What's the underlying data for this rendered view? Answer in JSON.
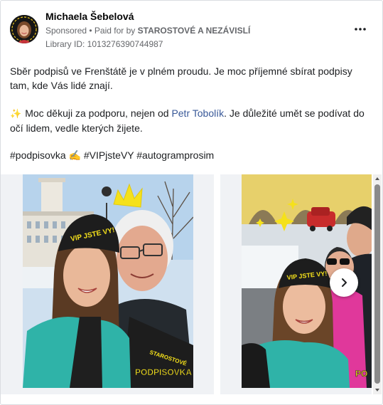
{
  "post": {
    "author": "Michaela Šebelová",
    "sponsored_label": "Sponsored",
    "separator": " • ",
    "paid_for_prefix": "Paid for by ",
    "paid_for_by": "STAROSTOVÉ A NEZÁVISLÍ",
    "library_id": "Library ID: 1013276390744987",
    "more_options_label": "•••",
    "paragraph1": "Sběr podpisů ve Frenštátě je v plném proudu. Je moc příjemné sbírat podpisy tam, kde Vás lidé znají.",
    "paragraph2_sparkle": "✨",
    "paragraph2_before": "Moc děkuji za podporu, nejen od ",
    "paragraph2_link": "Petr Tobolík",
    "paragraph2_after": ". Je důležité umět se podívat do očí lidem, vedle kterých žijete.",
    "hashtags": "#podpisovka ✍️ #VIPjsteVY #autogramprosim"
  },
  "photos": {
    "photo1_beanie_text": "VIP JSTE VY!",
    "photo1_sticker": "PODPISOVKA",
    "photo1_sash": "STAROSTOVÉ",
    "photo2_beanie_text": "VIP JSTE VY!",
    "photo2_sticker": "PO"
  },
  "icons": {
    "more": "more-options-icon",
    "next": "chevron-right-icon"
  },
  "colors": {
    "link": "#385898",
    "secondary_text": "#65676b",
    "sticker_yellow": "#f5e11b"
  }
}
